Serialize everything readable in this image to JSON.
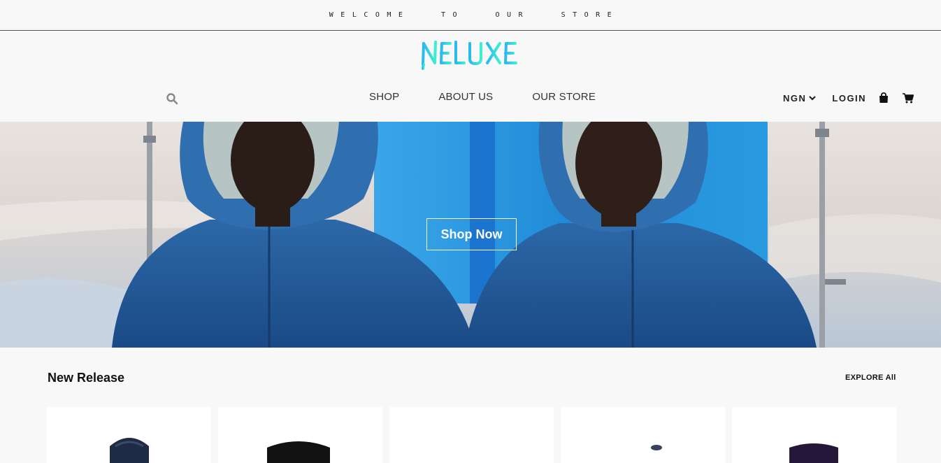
{
  "announcement": {
    "text": "Welcome to our store"
  },
  "header": {
    "logo_text": "NELUXE",
    "nav": [
      {
        "label": "SHOP"
      },
      {
        "label": "ABOUT US"
      },
      {
        "label": "OUR STORE"
      }
    ],
    "currency": "NGN",
    "login_label": "LOGIN",
    "icons": [
      "search-icon",
      "chevron-down-icon",
      "shopping-bag-icon",
      "cart-icon"
    ]
  },
  "hero": {
    "cta_label": "Shop Now"
  },
  "new_release": {
    "title": "New Release",
    "explore_label": "EXPLORE All",
    "product_count_visible": 5
  },
  "colors": {
    "logo": "#2fd0e8",
    "jacket": "#1e4f8c",
    "background": "#f8f8f8"
  }
}
